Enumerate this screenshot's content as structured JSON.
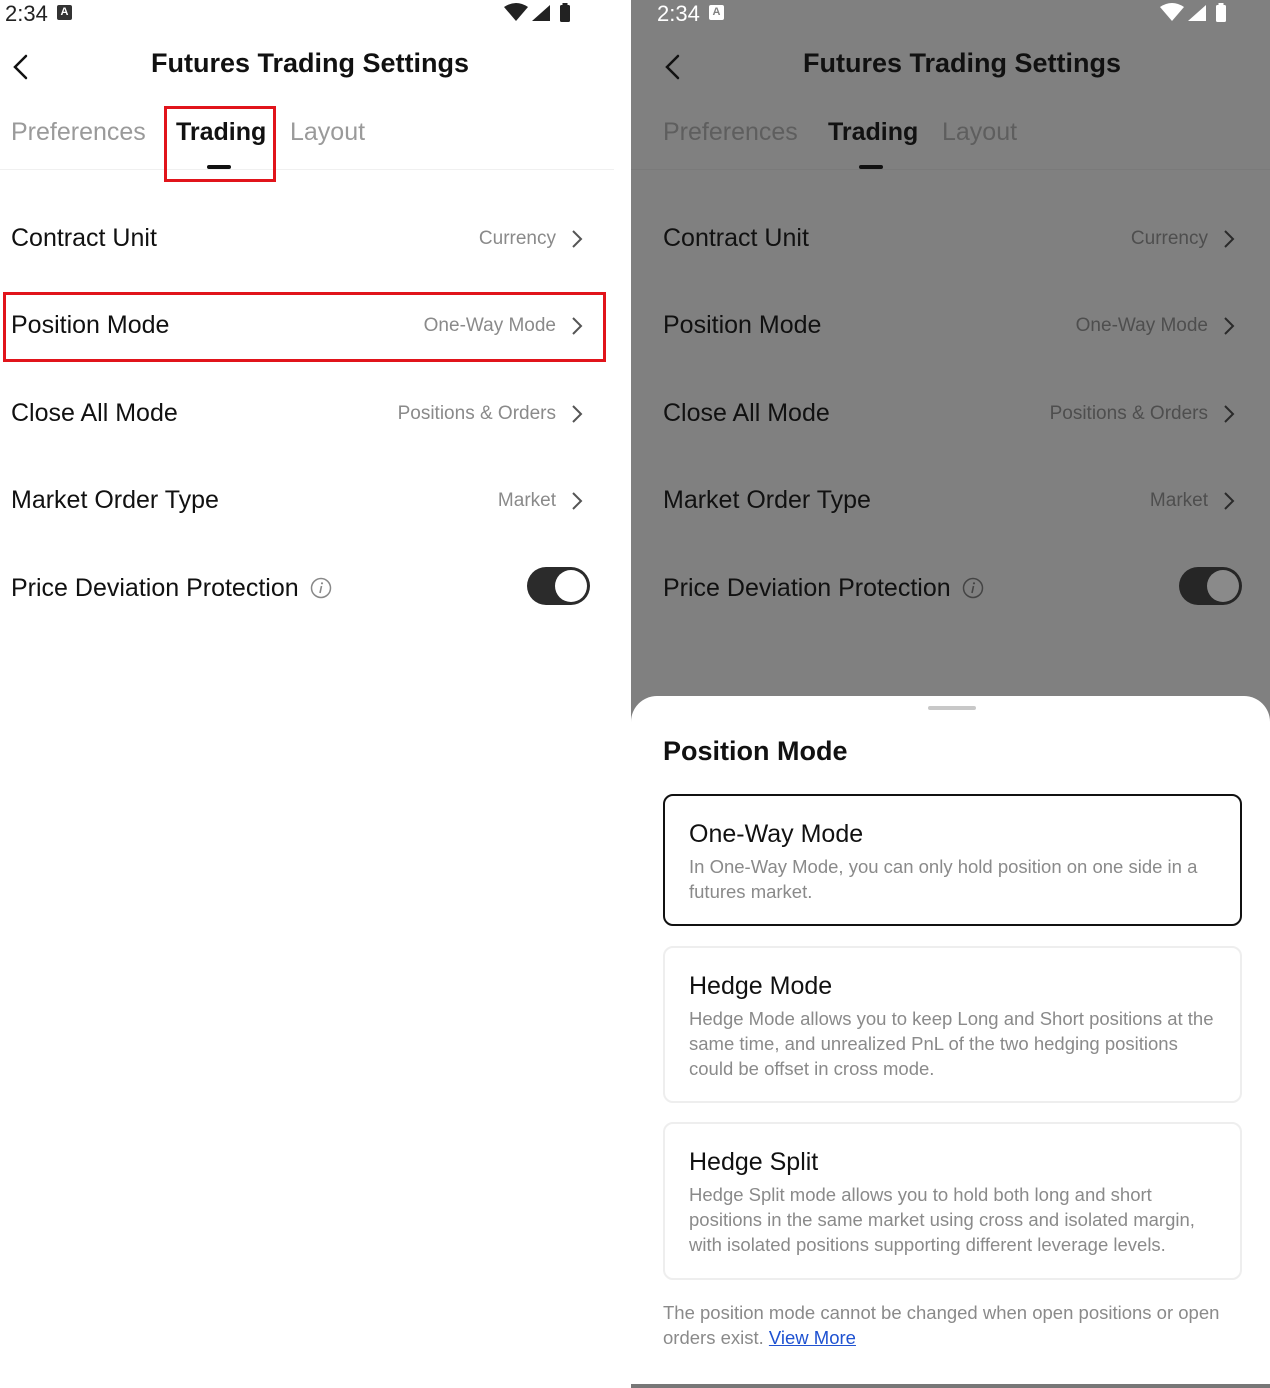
{
  "status": {
    "time": "2:34",
    "notif_letter": "A"
  },
  "header": {
    "title": "Futures Trading Settings"
  },
  "tabs": [
    {
      "label": "Preferences"
    },
    {
      "label": "Trading"
    },
    {
      "label": "Layout"
    }
  ],
  "active_tab": "Trading",
  "settings": {
    "contract_unit": {
      "label": "Contract Unit",
      "value": "Currency"
    },
    "position_mode": {
      "label": "Position Mode",
      "value": "One-Way Mode"
    },
    "close_all_mode": {
      "label": "Close All Mode",
      "value": "Positions & Orders"
    },
    "market_order_type": {
      "label": "Market Order Type",
      "value": "Market"
    },
    "price_deviation": {
      "label": "Price Deviation Protection",
      "enabled": true
    }
  },
  "sheet": {
    "title": "Position Mode",
    "options": [
      {
        "title": "One-Way Mode",
        "desc": "In One-Way Mode, you can only hold position on one side in a futures market.",
        "selected": true
      },
      {
        "title": "Hedge Mode",
        "desc": "Hedge Mode allows you to keep Long and Short positions at the same time, and unrealized PnL of the two hedging positions could be offset in cross mode.",
        "selected": false
      },
      {
        "title": "Hedge Split",
        "desc": "Hedge Split mode allows you to hold both long and short positions in the same market using cross and isolated margin, with isolated positions supporting different leverage levels.",
        "selected": false
      }
    ],
    "note": "The position mode cannot be changed when open positions or open orders exist.",
    "link": "View More"
  },
  "colors": {
    "highlight": "#e1141b",
    "link": "#1f52d1",
    "overlay": "#808080"
  }
}
